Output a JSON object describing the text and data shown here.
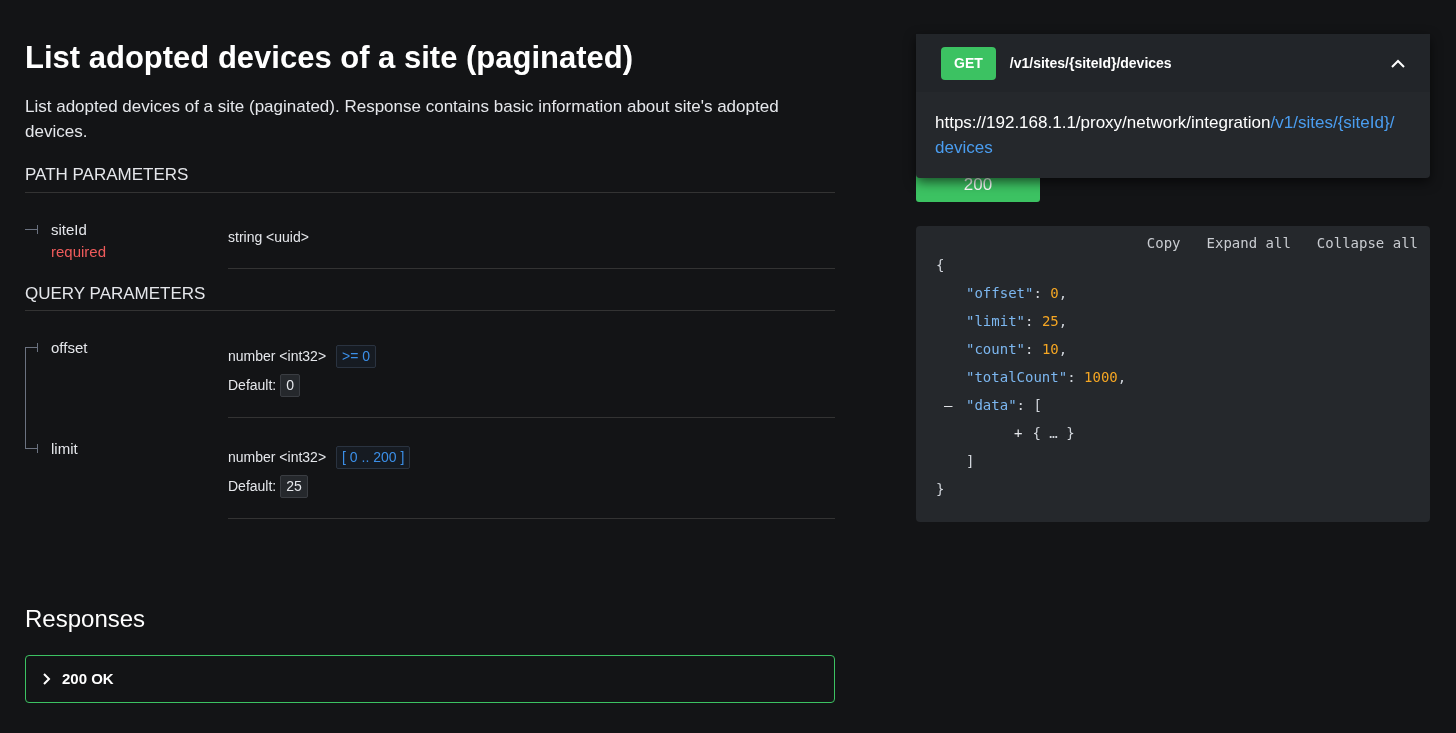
{
  "title": "List adopted devices of a site (paginated)",
  "description": "List adopted devices of a site (paginated). Response contains basic information about site's adopted devices.",
  "parameter_groups": [
    {
      "heading": "PATH PARAMETERS",
      "params": [
        {
          "name": "siteId",
          "required": "required",
          "type": "string <uuid>"
        }
      ]
    },
    {
      "heading": "QUERY PARAMETERS",
      "params": [
        {
          "name": "offset",
          "type": "number <int32>",
          "constraint": ">= 0",
          "default_label": "Default:",
          "default": "0"
        },
        {
          "name": "limit",
          "type": "number <int32>",
          "constraint": "[ 0 .. 200 ]",
          "default_label": "Default:",
          "default": "25"
        }
      ]
    }
  ],
  "responses": {
    "heading": "Responses",
    "items": [
      {
        "label": "200 OK",
        "expanded": false
      }
    ]
  },
  "endpoint": {
    "method": "GET",
    "path": "/v1/sites/{siteId}/devices",
    "expanded": true,
    "url_base": "https://192.168.1.1/proxy/network/integration",
    "url_path": "/v1/sites/{siteId}/devices"
  },
  "response_tabs": [
    {
      "label": "200",
      "selected": true
    }
  ],
  "code_sample": {
    "actions": [
      "Copy",
      "Expand all",
      "Collapse all"
    ],
    "root": {
      "open": "{",
      "close": "}",
      "children": [
        {
          "key": "\"offset\"",
          "sep": ":",
          "value": "0",
          "comma": ","
        },
        {
          "key": "\"limit\"",
          "sep": ":",
          "value": "25",
          "comma": ","
        },
        {
          "key": "\"count\"",
          "sep": ":",
          "value": "10",
          "comma": ","
        },
        {
          "key": "\"totalCount\"",
          "sep": ":",
          "value": "1000",
          "comma": ","
        },
        {
          "toggle": "–",
          "key": "\"data\"",
          "sep": ":",
          "open": "[",
          "close": "]",
          "children": [
            {
              "toggle": "+",
              "collapsed": "{ … }"
            }
          ]
        }
      ]
    }
  }
}
